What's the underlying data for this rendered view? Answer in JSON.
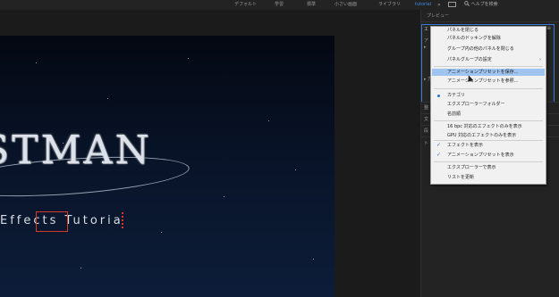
{
  "workspaces": [
    {
      "label": "デフォルト",
      "active": false
    },
    {
      "label": "学習",
      "active": false
    },
    {
      "label": "標準",
      "active": false
    },
    {
      "label": "小さい画面",
      "active": false
    },
    {
      "label": "ライブラリ",
      "active": false
    },
    {
      "label": "tutorial",
      "active": true
    }
  ],
  "workspace_overflow": "»",
  "search": {
    "icon": "search-icon",
    "label": "ヘルプを検索"
  },
  "preview_panel": {
    "title": "プレビュー"
  },
  "effects_panel": {
    "tab_label": "エ",
    "menu_icon": "hamburger-icon",
    "side_labels": [
      "ア",
      "▸",
      "▸ 方",
      "整",
      "文",
      "段",
      "ト"
    ]
  },
  "composition": {
    "title_text": "STMAN",
    "subtitle_text": "Effects Tutoria",
    "accent_color": "#d23a2a"
  },
  "context_menu": {
    "items": [
      {
        "label": "パネルを閉じる"
      },
      {
        "label": "パネルのドッキングを解除"
      },
      {
        "label": "グループ内の他のパネルを閉じる"
      },
      {
        "label": "パネルグループの設定",
        "submenu": true
      },
      {
        "label": "アニメーションプリセットを保存...",
        "highlighted": true
      },
      {
        "label": "アニメーションプリセットを参照..."
      },
      {
        "label": "カテゴリ",
        "radio": true
      },
      {
        "label": "エクスプローラーフォルダー"
      },
      {
        "label": "名前順"
      },
      {
        "label": "16 bpc 対応のエフェクトのみを表示"
      },
      {
        "label": "GPU 対応のエフェクトのみを表示"
      },
      {
        "label": "エフェクトを表示",
        "checked": true
      },
      {
        "label": "アニメーションプリセットを表示",
        "checked": true
      },
      {
        "label": "エクスプローラーで表示"
      },
      {
        "label": "リストを更新"
      }
    ],
    "submenu_arrow": "›",
    "check_mark": "✓"
  }
}
